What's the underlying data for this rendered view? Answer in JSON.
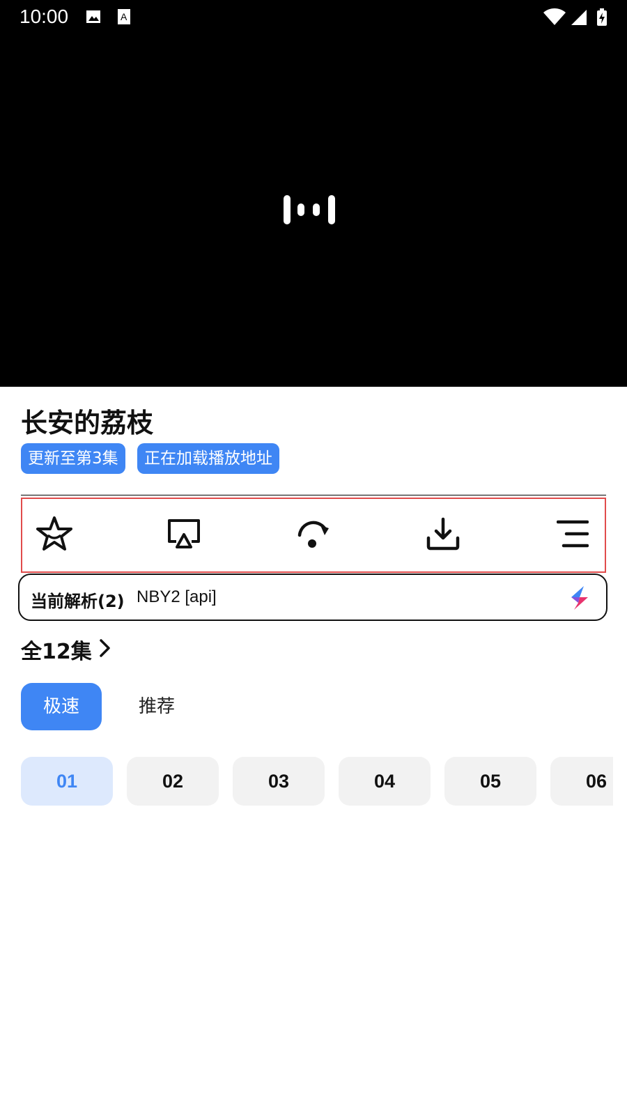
{
  "status_bar": {
    "time": "10:00"
  },
  "video": {
    "loading_icon": "loading-bars-icon"
  },
  "title": "长安的荔枝",
  "tags": [
    {
      "label": "更新至第3集",
      "color": "#3f86f4"
    },
    {
      "label": "正在加载播放地址",
      "color": "#3f86f4"
    }
  ],
  "toolbar": {
    "items": [
      {
        "name": "favorite",
        "icon": "star-icon"
      },
      {
        "name": "cast",
        "icon": "airplay-icon"
      },
      {
        "name": "skip",
        "icon": "skip-arc-icon"
      },
      {
        "name": "download",
        "icon": "download-icon"
      },
      {
        "name": "menu",
        "icon": "menu-lines-icon"
      }
    ]
  },
  "parser": {
    "label": "当前解析(2)",
    "value": "NBY2 [api]",
    "icon": "bolt-icon"
  },
  "episodes": {
    "header": "全12集",
    "tabs": [
      {
        "label": "极速",
        "active": true
      },
      {
        "label": "推荐",
        "active": false
      }
    ],
    "items": [
      "01",
      "02",
      "03",
      "04",
      "05",
      "06"
    ],
    "selected": "01"
  },
  "colors": {
    "accent": "#3f86f4",
    "toolbar_border": "#e14b4b",
    "chip_bg": "#f2f2f2",
    "chip_selected_bg": "#dde9fd"
  }
}
